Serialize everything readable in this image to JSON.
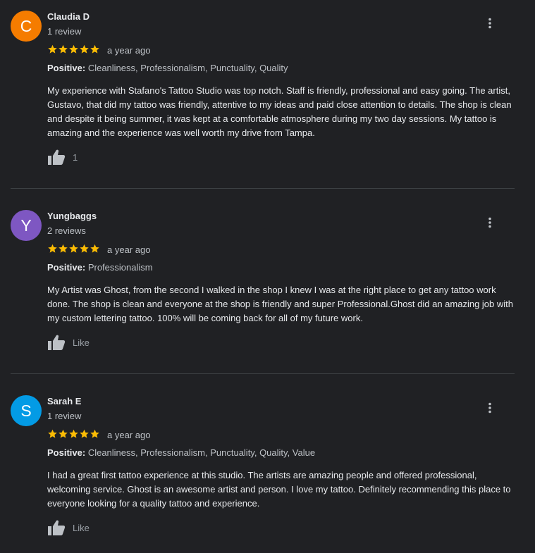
{
  "colors": {
    "background": "#202124",
    "star": "#fbbc04",
    "divider": "#3c4043"
  },
  "icons": {
    "star": "star-icon",
    "more": "more-vert-icon",
    "like": "thumbs-up-icon"
  },
  "reviews": [
    {
      "initial": "C",
      "avatar_color": "#f57c00",
      "name": "Claudia D",
      "count": "1 review",
      "rating": 5,
      "date": "a year ago",
      "positive_label": "Positive:",
      "positive_values": "Cleanliness, Professionalism, Punctuality, Quality",
      "text": "My experience with Stafano's Tattoo Studio was top notch. Staff is friendly, professional and easy going. The artist, Gustavo, that did my tattoo was friendly, attentive to my ideas and paid close attention to details. The shop is clean and despite it being summer, it was kept at a comfortable atmosphere during my two day sessions. My tattoo is amazing and the experience was well worth my drive from Tampa.",
      "like_label": "1"
    },
    {
      "initial": "Y",
      "avatar_color": "#7e57c2",
      "name": "Yungbaggs",
      "count": "2 reviews",
      "rating": 5,
      "date": "a year ago",
      "positive_label": "Positive:",
      "positive_values": "Professionalism",
      "text": "My Artist was Ghost, from the second I walked in the shop I knew I was at the right place to get any tattoo work done. The shop is clean and everyone at the shop is friendly and super Professional.Ghost did an amazing job with my custom lettering tattoo. 100% will be coming back for all of my future work.",
      "like_label": "Like"
    },
    {
      "initial": "S",
      "avatar_color": "#039be5",
      "name": "Sarah E",
      "count": "1 review",
      "rating": 5,
      "date": "a year ago",
      "positive_label": "Positive:",
      "positive_values": "Cleanliness, Professionalism, Punctuality, Quality, Value",
      "text": "I had a great first tattoo experience at this studio. The artists are amazing people and offered professional, welcoming service. Ghost is an awesome artist and person. I love my tattoo. Definitely recommending this place to everyone looking for a quality tattoo and experience.",
      "like_label": "Like"
    }
  ]
}
